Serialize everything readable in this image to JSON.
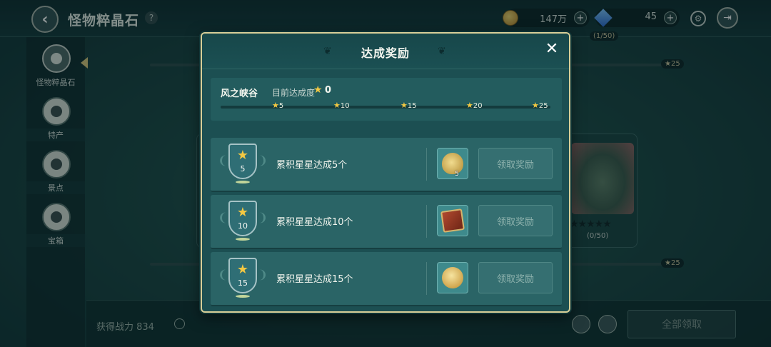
{
  "header": {
    "title": "怪物粹晶石",
    "help_icon": "?",
    "coins": "147万",
    "gems": "45",
    "plus": "+"
  },
  "sidebar": {
    "items": [
      {
        "label": "怪物粹晶石",
        "icon": "monster-icon",
        "active": true
      },
      {
        "label": "特产",
        "icon": "specialty-icon",
        "active": false
      },
      {
        "label": "景点",
        "icon": "scenery-icon",
        "active": false
      },
      {
        "label": "宝箱",
        "icon": "chest-icon",
        "active": false
      }
    ]
  },
  "background": {
    "progress_top_label": "(1/50)",
    "star_label_1": "★25",
    "star_label_2": "★25",
    "monster_count": "(0/50)",
    "monster_stars": "★★★★★",
    "power_text": "获得战力 834",
    "claim_all": "全部领取"
  },
  "modal": {
    "title": "达成奖励",
    "close": "✕",
    "region": {
      "name": "风之峡谷",
      "progress_label": "目前达成度",
      "progress_value": "0",
      "star": "★"
    },
    "milestones": [
      "5",
      "10",
      "15",
      "20",
      "25"
    ],
    "rewards": [
      {
        "badge_number": "5",
        "description": "累积星星达成5个",
        "item_icon": "gold-bag-icon",
        "item_qty": "5",
        "button": "领取奖励"
      },
      {
        "badge_number": "10",
        "description": "累积星星达成10个",
        "item_icon": "book-icon",
        "item_qty": "",
        "button": "领取奖励"
      },
      {
        "badge_number": "15",
        "description": "累积星星达成15个",
        "item_icon": "treasure-bag-icon",
        "item_qty": "",
        "button": "领取奖励"
      }
    ]
  },
  "colors": {
    "star": "#f3c842",
    "modal_border": "#d8cf98",
    "modal_bg": "#1c4f52"
  }
}
